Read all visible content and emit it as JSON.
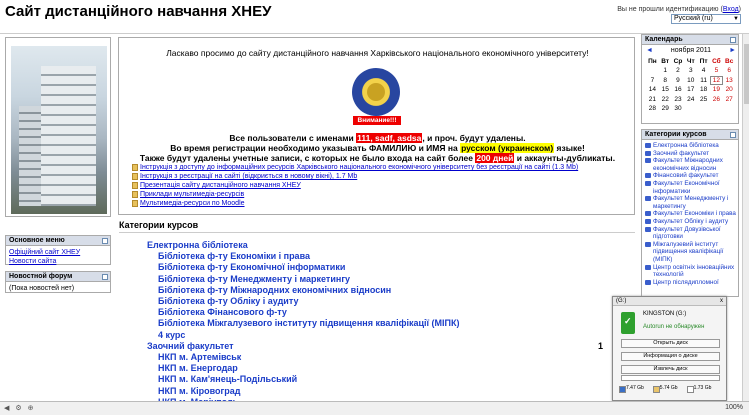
{
  "header": {
    "site_title": "Сайт дистанційного навчання ХНЕУ",
    "login_text": "Вы не прошли идентификацию (",
    "login_link": "Вход",
    "login_end": ")",
    "language": "Русский (ru)"
  },
  "blocks": {
    "main_menu": {
      "title": "Основное меню",
      "items": [
        "Офіційний сайт ХНЕУ",
        "Новости сайта"
      ]
    },
    "news_forum": {
      "title": "Новостной форум",
      "empty": "(Пока новостей нет)"
    }
  },
  "main": {
    "welcome": "Ласкаво просимо до сайту дистанційного навчання Харківського національного економічного університету!",
    "attention": "Внимание!!!",
    "notice1_a": "Все пользователи с именами ",
    "notice1_hl": "111, sadf, asdsa",
    "notice1_b": ", и проч. будут удалены.",
    "notice2_a": "Во время регистрации необходимо указывать ФАМИЛИЮ и ИМЯ на ",
    "notice2_hl": "русском (украинском)",
    "notice2_b": " языке!",
    "notice3_a": "Также будут удалены учетные записи, с которых не было входа на сайт более ",
    "notice3_hl": "200 дней",
    "notice3_b": " и аккаунты-дубликаты.",
    "links": [
      "Інструкція з доступу до інформаційних ресурсів Харківського національного економічного університету без реєстрації на сайті (1.3 Mb)",
      "Інструкція з реєстрації на сайті (відкриється в новому вікні), 1.7 Mb",
      "Презентація сайту дистанційного навчання ХНЕУ",
      "Приклади мультимедіа-ресурсів",
      "Мультимедіа-ресурси по Moodle"
    ]
  },
  "categories": {
    "heading": "Категории курсов",
    "items": [
      {
        "label": "Електронна бібліотека",
        "sub": false
      },
      {
        "label": "Бібліотека ф-ту Економіки і права",
        "sub": true
      },
      {
        "label": "Бібліотека ф-ту Економічної інформатики",
        "sub": true
      },
      {
        "label": "Бібліотека ф-ту Менеджменту і маркетингу",
        "sub": true
      },
      {
        "label": "Бібліотека ф-ту Міжнародних економічних відносин",
        "sub": true
      },
      {
        "label": "Бібліотека ф-ту Обліку і аудиту",
        "sub": true
      },
      {
        "label": "Бібліотека Фінансового ф-ту",
        "sub": true
      },
      {
        "label": "Бібліотека Міжгалузевого інституту підвищення кваліфікації (МІПК)",
        "sub": true
      },
      {
        "label": "4 курс",
        "sub": true
      },
      {
        "label": "Заочний факультет",
        "sub": false
      },
      {
        "label": "НКП м. Артемівськ",
        "sub": true
      },
      {
        "label": "НКП м. Енергодар",
        "sub": true
      },
      {
        "label": "НКП м. Кам'янець-Подільський",
        "sub": true
      },
      {
        "label": "НКП м. Кіровоград",
        "sub": true
      },
      {
        "label": "НКП м. Маріуполь",
        "sub": true
      }
    ],
    "count": "1"
  },
  "calendar": {
    "title": "Календарь",
    "month": "ноября 2011",
    "prev": "◄",
    "next": "►",
    "weekdays": [
      "Пн",
      "Вт",
      "Ср",
      "Чт",
      "Пт",
      "Сб",
      "Вс"
    ],
    "weeks": [
      [
        "",
        "1",
        "2",
        "3",
        "4",
        "5",
        "6"
      ],
      [
        "7",
        "8",
        "9",
        "10",
        "11",
        "12",
        "13"
      ],
      [
        "14",
        "15",
        "16",
        "17",
        "18",
        "19",
        "20"
      ],
      [
        "21",
        "22",
        "23",
        "24",
        "25",
        "26",
        "27"
      ],
      [
        "28",
        "29",
        "30",
        "",
        "",
        "",
        ""
      ]
    ],
    "today": "12"
  },
  "course_categories": {
    "title": "Категории курсов",
    "items": [
      "Електронна бібліотека",
      "Заочний факультет",
      "Факультет Міжнародних економічних відносин",
      "Фінансовий факультет",
      "Факультет Економічної інформатики",
      "Факультет Менеджменту і маркетингу",
      "Факультет Економіки і права",
      "Факультет Обліку і аудиту",
      "Факультет Довузівської підготовки",
      "Міжгалузевий інститут підвищення кваліфікації (МІПК)",
      "Центр освітніх інноваційних технологій",
      "Центр післядипломної"
    ]
  },
  "usb_popup": {
    "title": "(G:)",
    "close": "x",
    "device": "KINGSTON (G:)",
    "status": "Autorun не обнаружен",
    "buttons": [
      "Открыть диск",
      "Информация о диске",
      "Извлечь диск"
    ],
    "stats": [
      "7.47 Gb",
      "5.74 Gb",
      "1.73 Gb"
    ]
  },
  "statusbar": {
    "zoom": "100%"
  }
}
